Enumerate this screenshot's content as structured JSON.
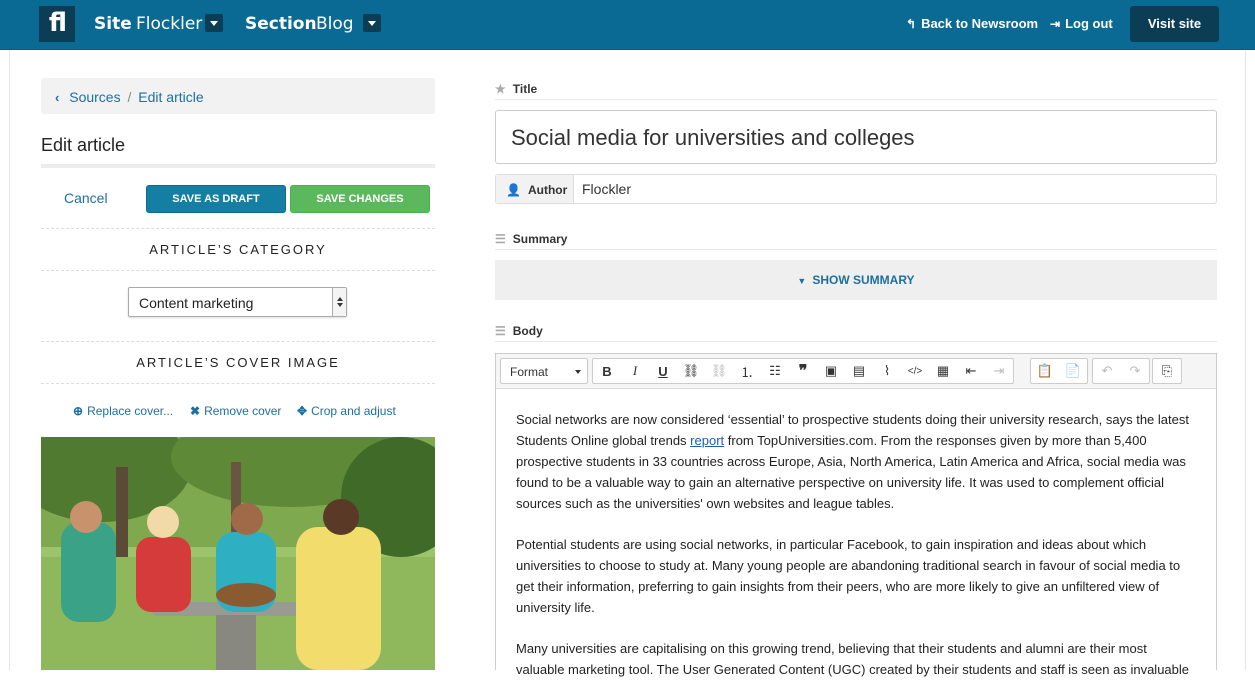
{
  "topbar": {
    "logo_text": "fl",
    "site_label": "Site",
    "site_value": "Flockler",
    "section_label": "Section",
    "section_value": "Blog",
    "back_link": "Back to Newsroom",
    "logout_link": "Log out",
    "visit_site": "Visit site",
    "color": "#0a6a93"
  },
  "sidebar": {
    "breadcrumb": {
      "root": "Sources",
      "separator": "/",
      "current": "Edit article"
    },
    "heading": "Edit article",
    "cancel": "Cancel",
    "save_draft": "SAVE AS DRAFT",
    "save_changes": "SAVE CHANGES",
    "category_heading": "ARTICLE’S CATEGORY",
    "category_value": "Content marketing",
    "cover_heading": "ARTICLE’S COVER IMAGE",
    "replace_cover": "Replace cover...",
    "remove_cover": "Remove cover",
    "crop_adjust": "Crop and adjust"
  },
  "form": {
    "title_label": "Title",
    "title_value": "Social media for universities and colleges",
    "author_label": "Author",
    "author_value": "Flockler",
    "summary_label": "Summary",
    "show_summary": "SHOW SUMMARY",
    "body_label": "Body",
    "format_select": "Format",
    "body_paragraphs": [
      {
        "before": "Social networks are now considered ‘essential’ to prospective students doing their university research, says the latest Students Online global trends ",
        "link": "report",
        "after": " from TopUniversities.com. From the responses given by more than 5,400 prospective students in 33 countries across Europe, Asia, North America, Latin America and Africa, social media was found to be a valuable way to gain an alternative perspective on university life. It was used to complement official sources such as the universities' own websites and league tables."
      },
      {
        "text": "Potential students are using social networks, in particular Facebook, to gain inspiration and ideas about which universities to choose to study at. Many young people are abandoning traditional search in favour of social media to get their information, preferring to gain insights from their peers, who are more likely to give an unfiltered view of university life."
      },
      {
        "text": "Many universities are capitalising on this growing trend, believing that their students and alumni are their most valuable marketing tool. The User Generated Content (UGC) created by their students and staff is seen as invaluable"
      }
    ]
  }
}
